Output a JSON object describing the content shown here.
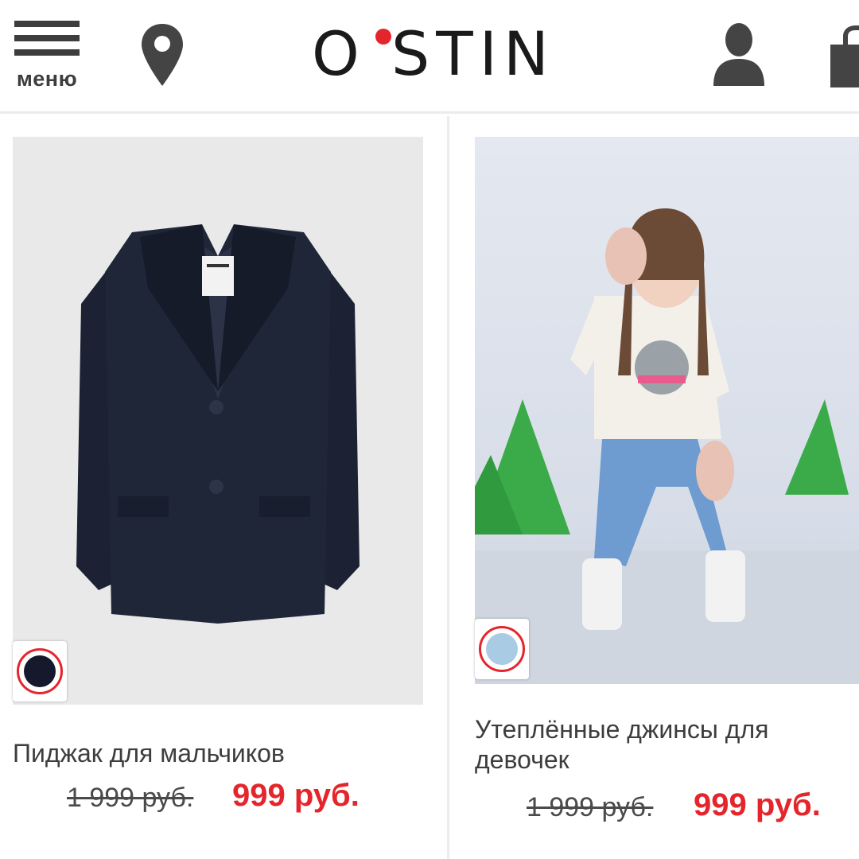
{
  "header": {
    "menu_label": "меню",
    "logo_text": "O STIN",
    "brand_color": "#e4262c",
    "icons": [
      "hamburger-icon",
      "location-pin-icon",
      "user-icon",
      "shopping-bag-icon"
    ]
  },
  "products": [
    {
      "title": "Пиджак для мальчиков",
      "old_price": "1 999 руб.",
      "new_price": "999 руб.",
      "swatch_color": "#141a2b"
    },
    {
      "title": "Утеплённые джинсы для девочек",
      "old_price": "1 999 руб.",
      "new_price": "999 руб.",
      "swatch_color": "#a9cbe3"
    }
  ]
}
